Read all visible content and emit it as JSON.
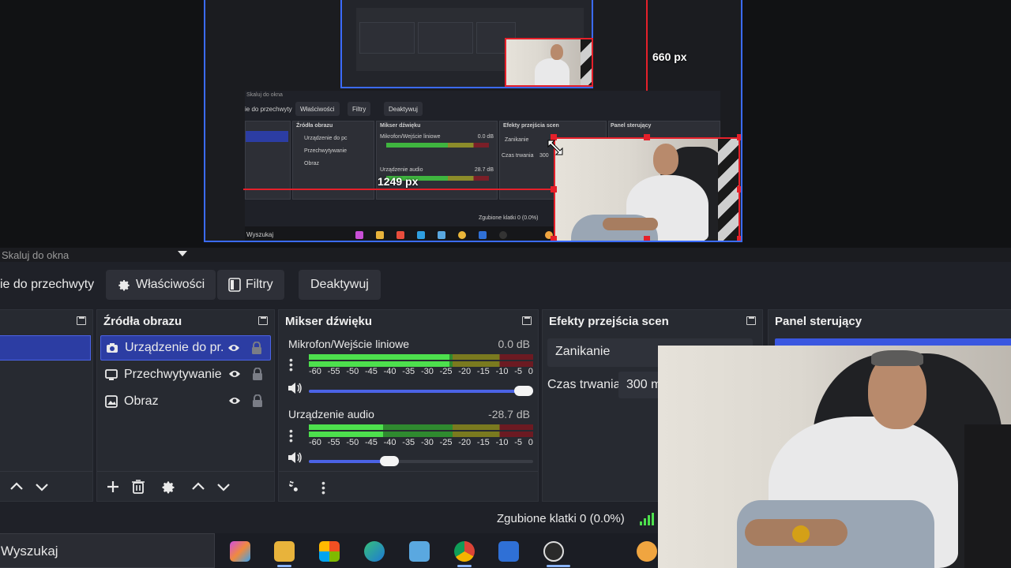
{
  "preview": {
    "width_label": "660 px",
    "height_label": "1249 px",
    "mini_scale": "Skaluj do okna",
    "mini_buttons": [
      "ie do przechwyty",
      "Właściwości",
      "Filtry",
      "Deaktywuj"
    ],
    "mini_docks": [
      "Źródła obrazu",
      "Mikser dźwięku",
      "Efekty przejścia scen",
      "Panel sterujący"
    ],
    "mini_sources": [
      "Urządzenie do pc",
      "Przechwytywanie",
      "Obraz"
    ],
    "mini_mixer": [
      "Mikrofon/Wejście liniowe",
      "Urządzenie audio"
    ],
    "mini_mixer_db": [
      "0.0 dB",
      "28.7 dB"
    ],
    "mini_fade": "Zanikanie",
    "mini_duration": "Czas trwania",
    "mini_duration_value": "300",
    "mini_dropped": "Zgubione klatki 0 (0.0%)",
    "mini_search": "Wyszukaj"
  },
  "toolbar": {
    "scale_label": "Skaluj do okna",
    "capture_label": "ie do przechwyty",
    "properties_label": "Właściwości",
    "filters_label": "Filtry",
    "deactivate_label": "Deaktywuj"
  },
  "sources": {
    "title": "Źródła obrazu",
    "items": [
      {
        "label": "Urządzenie do pr.",
        "icon": "camera-icon",
        "selected": true
      },
      {
        "label": "Przechwytywanie",
        "icon": "monitor-icon",
        "selected": false
      },
      {
        "label": "Obraz",
        "icon": "image-icon",
        "selected": false
      }
    ]
  },
  "mixer": {
    "title": "Mikser dźwięku",
    "ticks": [
      "-60",
      "-55",
      "-50",
      "-45",
      "-40",
      "-35",
      "-30",
      "-25",
      "-20",
      "-15",
      "-10",
      "-5",
      "0"
    ],
    "channels": [
      {
        "name": "Mikrofon/Wejście liniowe",
        "db": "0.0 dB",
        "level": 0.95,
        "volume": 1.0
      },
      {
        "name": "Urządzenie audio",
        "db": "-28.7 dB",
        "level": 0.5,
        "volume": 0.4
      }
    ]
  },
  "transitions": {
    "title": "Efekty przejścia scen",
    "selected": "Zanikanie",
    "duration_label": "Czas trwania",
    "duration_value": "300 m"
  },
  "control": {
    "title": "Panel sterujący"
  },
  "status": {
    "dropped": "Zgubione klatki 0 (0.0%)"
  },
  "taskbar": {
    "search": "Wyszukaj"
  },
  "colors": {
    "accent": "#3b6bff",
    "selection": "#2c3da3",
    "guide_red": "#e5202a"
  }
}
